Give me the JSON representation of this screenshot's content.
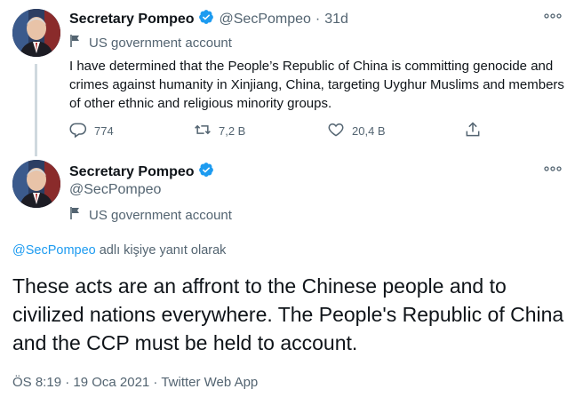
{
  "tweet1": {
    "display_name": "Secretary Pompeo",
    "handle": "@SecPompeo",
    "separator": "·",
    "age": "31d",
    "gov_label": "US government account",
    "text": "I have determined that the People’s Republic of China is committing genocide and crimes against humanity in Xinjiang, China, targeting Uyghur Muslims and members of other ethnic and religious minority groups.",
    "replies": "774",
    "retweets": "7,2 B",
    "likes": "20,4 B"
  },
  "tweet2": {
    "display_name": "Secretary Pompeo",
    "handle": "@SecPompeo",
    "gov_label": "US government account",
    "reply_to_handle": "@SecPompeo",
    "reply_to_suffix": " adlı kişiye yanıt olarak",
    "text": "These acts are an affront to the Chinese people and to civilized nations everywhere. The People's Republic of China and the CCP must be held to account.",
    "meta": "ÖS 8:19 · 19 Oca 2021 · Twitter Web App"
  },
  "icons": {
    "verified": "verified-badge-icon",
    "more": "more-options-icon",
    "gov": "flag-icon",
    "reply": "reply-icon",
    "retweet": "retweet-icon",
    "like": "heart-icon",
    "share": "share-icon"
  },
  "colors": {
    "text": "#0f1419",
    "muted": "#536471",
    "accent": "#1d9bf0",
    "thread_line": "#cfd9de"
  }
}
